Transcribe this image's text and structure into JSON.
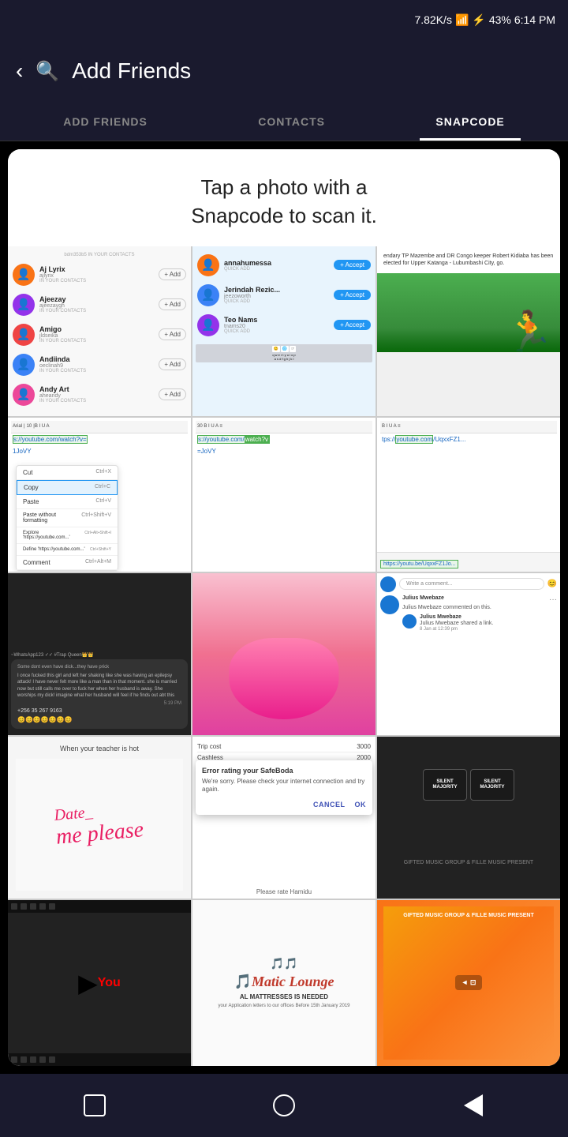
{
  "statusBar": {
    "speed": "7.82K/s",
    "battery": "43%",
    "time": "6:14 PM"
  },
  "header": {
    "title": "Add Friends",
    "backLabel": "‹",
    "searchLabel": "🔍"
  },
  "tabs": [
    {
      "id": "add-friends",
      "label": "ADD FRIENDS",
      "active": false
    },
    {
      "id": "contacts",
      "label": "CONTACTS",
      "active": false
    },
    {
      "id": "snapcode",
      "label": "SNAPCODE",
      "active": true
    }
  ],
  "snapcode": {
    "title": "Tap a photo with a\nSnapcode to scan it."
  },
  "contacts": [
    {
      "name": "Aj Lyrix",
      "username": "ajlyrix",
      "sublabel": "IN YOUR CONTACTS",
      "color": "orange"
    },
    {
      "name": "Ajeezay",
      "username": "ajeezaygh",
      "sublabel": "IN YOUR CONTACTS",
      "color": "purple"
    },
    {
      "name": "Amigo",
      "username": "jldseika",
      "sublabel": "IN YOUR CONTACTS",
      "color": "red"
    },
    {
      "name": "Andiinda",
      "username": "oeclinah9",
      "sublabel": "IN YOUR CONTACTS",
      "color": "blue"
    },
    {
      "name": "Andy Art",
      "username": "aheandy",
      "sublabel": "IN YOUR CONTACTS",
      "color": "pink"
    }
  ],
  "friendRequests": [
    {
      "name": "annahumessa",
      "username": "",
      "sublabel": "QUICK ADD",
      "color": "orange"
    },
    {
      "name": "Jerindah Rezic...",
      "username": "jeezoworth",
      "sublabel": "QUICK ADD",
      "color": "blue"
    },
    {
      "name": "Teo Nams",
      "username": "tnams20",
      "sublabel": "QUICK ADD",
      "color": "purple"
    }
  ],
  "newsHeadline": "endary TP Mazembe and DR Congo keeper Robert Kidiaba has been elected for Upper Katanga - Lubumbashi City, go.",
  "editorUrls": [
    "s://youtube.com/watch?v=1JoVY",
    "s://youtube.com/watch?v=JoVY",
    "tps://youtube.com/UqxxFZ1..."
  ],
  "contextMenuItems": [
    {
      "label": "Cut",
      "shortcut": "Ctrl+X"
    },
    {
      "label": "Copy",
      "shortcut": "Ctrl+C",
      "highlighted": true
    },
    {
      "label": "Paste",
      "shortcut": "Ctrl+V"
    },
    {
      "label": "Paste without formatting",
      "shortcut": "Ctrl+Shift+V"
    },
    {
      "label": "Explore 'https://youtube.com...'",
      "shortcut": "Ctrl+Alt+Shift+I"
    },
    {
      "label": "Define 'https://youtube.com...'",
      "shortcut": "Ctrl+Shift+Y"
    },
    {
      "label": "Comment",
      "shortcut": "Ctrl+Alt+M"
    }
  ],
  "bottomUrlCell": "https://youtu.be/UqxxFZ1Jo...",
  "chatMessage": "Some dont even have dick...they have prick\n\nI once fucked this girl and left her shaking like she was having an epilepsy attack! I have never felt more like a man than in that moment. she is married now but still calls me over to fuck her when her husband is away. She worships my dick! imagine what her husband will feel if he finds out abt this",
  "fbComment": {
    "placeholder": "Write a comment...",
    "userName": "Julius Mwebaze",
    "text": "Julius Mwebaze commented on this.",
    "subText": "Julius Mwebaze shared a link.",
    "date": "8 Jan at 12:39 pm"
  },
  "teacherText": "When your teacher is hot",
  "dateMePlease": "Date_ me please",
  "tripCost": {
    "label": "Trip cost",
    "value": "3000",
    "cashless": "2000"
  },
  "errorDialog": {
    "title": "Error rating your SafeBoda",
    "text": "We're sorry. Please check your internet connection and try again.",
    "cancelBtn": "CANCEL",
    "okBtn": "OK"
  },
  "rateLabel": "Please rate Hamidu",
  "caps": [
    {
      "text": "SILENT\nMAJORITY",
      "color": "dark"
    },
    {
      "text": "SILENT\nMAJORITY",
      "color": "dark"
    }
  ],
  "maticLounge": {
    "name": "Matic Lounge",
    "notice": "your Application letters to our offices Before 15th January 2019"
  },
  "bottomNav": {
    "square": "□",
    "circle": "○",
    "triangle": "◁"
  }
}
